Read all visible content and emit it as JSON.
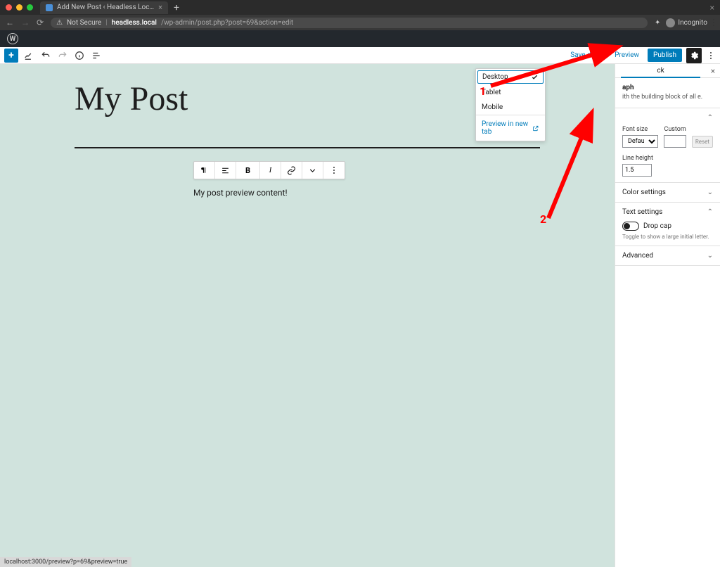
{
  "browser": {
    "tab_title": "Add New Post ‹ Headless Loc…",
    "security": "Not Secure",
    "host": "headless.local",
    "path": "/wp-admin/post.php?post=69&action=edit",
    "incognito": "Incognito"
  },
  "editor": {
    "save_draft": "Save draft",
    "preview": "Preview",
    "publish": "Publish"
  },
  "preview_menu": {
    "desktop": "Desktop",
    "tablet": "Tablet",
    "mobile": "Mobile",
    "new_tab": "Preview in new tab"
  },
  "post": {
    "title": "My Post",
    "content": "My post preview content!"
  },
  "sidebar": {
    "tab_block": "ck",
    "block_name": "aph",
    "block_desc": "ith the building block of all e.",
    "typography": {
      "font_size": "Font size",
      "custom": "Custom",
      "default_option": "Default",
      "reset": "Reset",
      "line_height": "Line height",
      "line_height_val": "1.5"
    },
    "color": "Color settings",
    "text": "Text settings",
    "drop_cap": "Drop cap",
    "drop_cap_help": "Toggle to show a large initial letter.",
    "advanced": "Advanced"
  },
  "annotations": {
    "one": "1",
    "two": "2"
  },
  "status_bar": "localhost:3000/preview?p=69&preview=true"
}
